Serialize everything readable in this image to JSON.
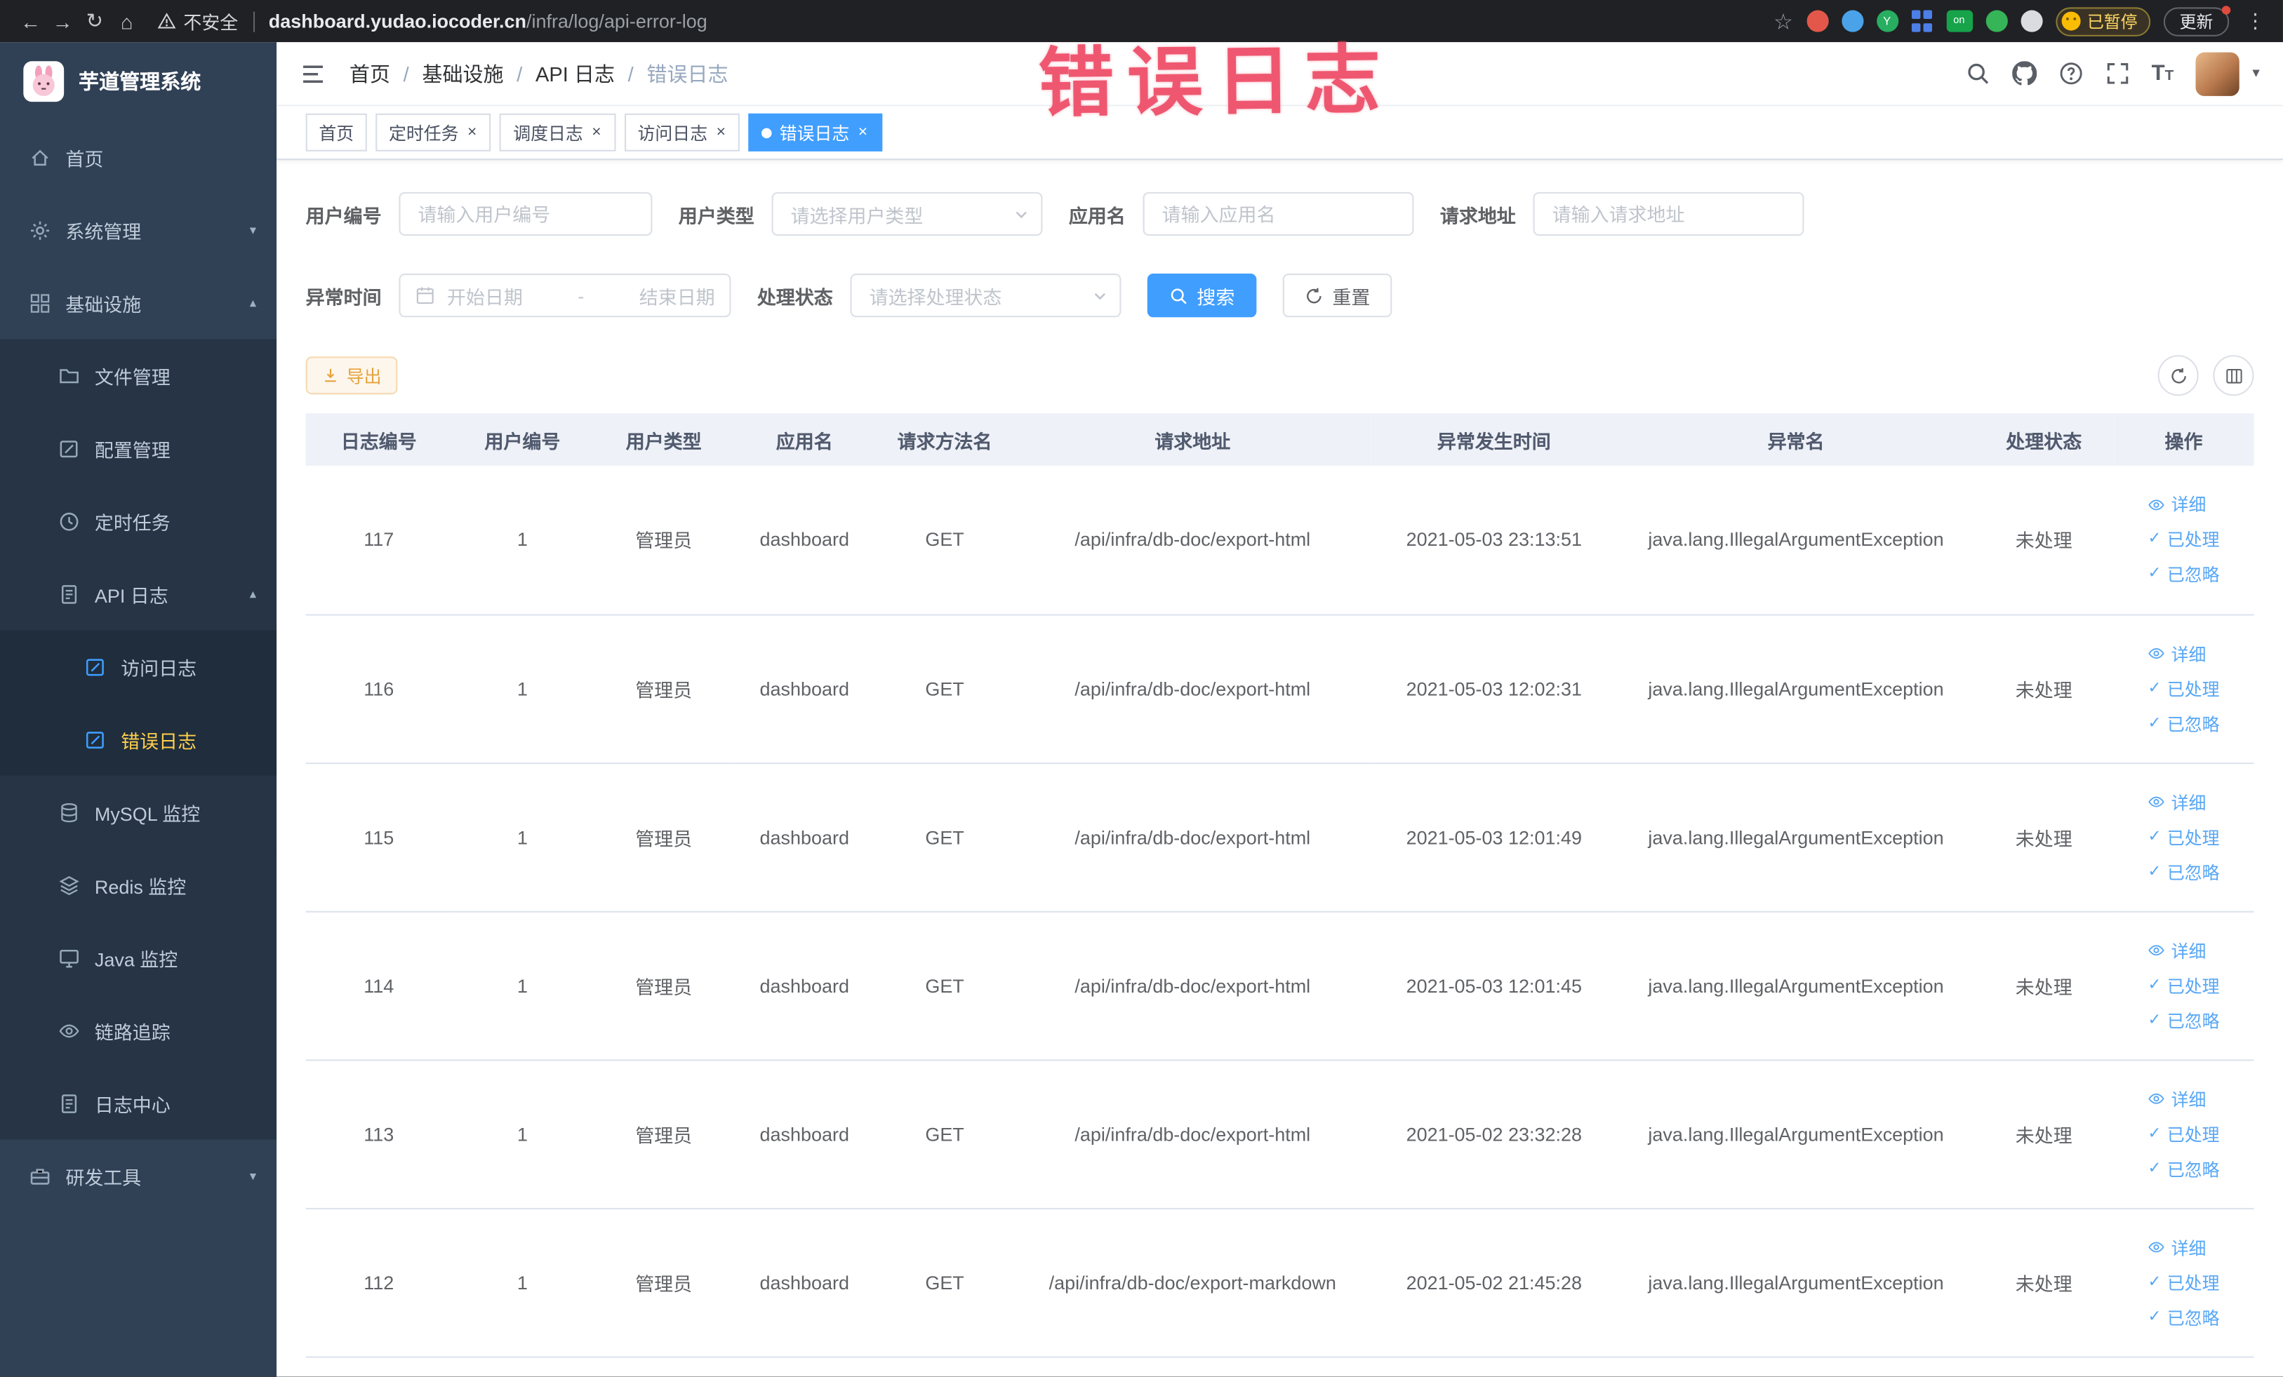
{
  "browser": {
    "security_label": "不安全",
    "url_domain": "dashboard.yudao.iocoder.cn",
    "url_path": "/infra/log/api-error-log",
    "paused_badge": "已暂停",
    "update_button": "更新",
    "extension_on_badge": "on",
    "extension_y_badge": "Y"
  },
  "annotation": {
    "text": "错误日志",
    "color": "#ee4b66"
  },
  "sidebar": {
    "logo_title": "芋道管理系统",
    "items": [
      {
        "label": "首页",
        "icon": "home-icon",
        "level": 1
      },
      {
        "label": "系统管理",
        "icon": "gear-icon",
        "level": 1,
        "expanded": false
      },
      {
        "label": "基础设施",
        "icon": "grid-icon",
        "level": 1,
        "expanded": true
      },
      {
        "label": "文件管理",
        "icon": "folder-icon",
        "level": 2
      },
      {
        "label": "配置管理",
        "icon": "edit-icon",
        "level": 2
      },
      {
        "label": "定时任务",
        "icon": "clock-icon",
        "level": 2
      },
      {
        "label": "API 日志",
        "icon": "doc-icon",
        "level": 2,
        "expanded": true
      },
      {
        "label": "访问日志",
        "icon": "edit-square-icon",
        "level": 3,
        "active": false
      },
      {
        "label": "错误日志",
        "icon": "edit-square-icon",
        "level": 3,
        "active": true
      },
      {
        "label": "MySQL 监控",
        "icon": "database-icon",
        "level": 2
      },
      {
        "label": "Redis 监控",
        "icon": "layers-icon",
        "level": 2
      },
      {
        "label": "Java 监控",
        "icon": "monitor-icon",
        "level": 2
      },
      {
        "label": "链路追踪",
        "icon": "eye-icon",
        "level": 2
      },
      {
        "label": "日志中心",
        "icon": "doc-icon",
        "level": 2
      },
      {
        "label": "研发工具",
        "icon": "toolbox-icon",
        "level": 1,
        "expanded": false
      }
    ]
  },
  "header": {
    "breadcrumb": [
      "首页",
      "基础设施",
      "API 日志",
      "错误日志"
    ]
  },
  "tabs": [
    {
      "label": "首页",
      "closable": false,
      "active": false
    },
    {
      "label": "定时任务",
      "closable": true,
      "active": false
    },
    {
      "label": "调度日志",
      "closable": true,
      "active": false
    },
    {
      "label": "访问日志",
      "closable": true,
      "active": false
    },
    {
      "label": "错误日志",
      "closable": true,
      "active": true
    }
  ],
  "filters": {
    "user_id": {
      "label": "用户编号",
      "placeholder": "请输入用户编号"
    },
    "user_type": {
      "label": "用户类型",
      "placeholder": "请选择用户类型"
    },
    "app_name": {
      "label": "应用名",
      "placeholder": "请输入应用名"
    },
    "request_url": {
      "label": "请求地址",
      "placeholder": "请输入请求地址"
    },
    "exception_time": {
      "label": "异常时间",
      "start_placeholder": "开始日期",
      "separator": "-",
      "end_placeholder": "结束日期"
    },
    "process_status": {
      "label": "处理状态",
      "placeholder": "请选择处理状态"
    },
    "search_label": "搜索",
    "reset_label": "重置"
  },
  "toolbar": {
    "export_label": "导出"
  },
  "table": {
    "columns": [
      "日志编号",
      "用户编号",
      "用户类型",
      "应用名",
      "请求方法名",
      "请求地址",
      "异常发生时间",
      "异常名",
      "处理状态",
      "操作"
    ],
    "row_actions": {
      "detail": "详细",
      "processed": "已处理",
      "ignored": "已忽略"
    },
    "rows": [
      {
        "log_id": "117",
        "user_id": "1",
        "user_type": "管理员",
        "app": "dashboard",
        "method": "GET",
        "url": "/api/infra/db-doc/export-html",
        "time": "2021-05-03 23:13:51",
        "exception": "java.lang.IllegalArgumentException",
        "status": "未处理"
      },
      {
        "log_id": "116",
        "user_id": "1",
        "user_type": "管理员",
        "app": "dashboard",
        "method": "GET",
        "url": "/api/infra/db-doc/export-html",
        "time": "2021-05-03 12:02:31",
        "exception": "java.lang.IllegalArgumentException",
        "status": "未处理"
      },
      {
        "log_id": "115",
        "user_id": "1",
        "user_type": "管理员",
        "app": "dashboard",
        "method": "GET",
        "url": "/api/infra/db-doc/export-html",
        "time": "2021-05-03 12:01:49",
        "exception": "java.lang.IllegalArgumentException",
        "status": "未处理"
      },
      {
        "log_id": "114",
        "user_id": "1",
        "user_type": "管理员",
        "app": "dashboard",
        "method": "GET",
        "url": "/api/infra/db-doc/export-html",
        "time": "2021-05-03 12:01:45",
        "exception": "java.lang.IllegalArgumentException",
        "status": "未处理"
      },
      {
        "log_id": "113",
        "user_id": "1",
        "user_type": "管理员",
        "app": "dashboard",
        "method": "GET",
        "url": "/api/infra/db-doc/export-html",
        "time": "2021-05-02 23:32:28",
        "exception": "java.lang.IllegalArgumentException",
        "status": "未处理"
      },
      {
        "log_id": "112",
        "user_id": "1",
        "user_type": "管理员",
        "app": "dashboard",
        "method": "GET",
        "url": "/api/infra/db-doc/export-markdown",
        "time": "2021-05-02 21:45:28",
        "exception": "java.lang.IllegalArgumentException",
        "status": "未处理"
      }
    ]
  },
  "colors": {
    "accent": "#409eff",
    "sidebar_bg": "#304156",
    "submenu_bg": "#263445",
    "active_menu_text": "#ffd04b",
    "warning_text": "#e6a23c",
    "annotation": "#ee4b66",
    "action_link": "#58a7f5"
  }
}
